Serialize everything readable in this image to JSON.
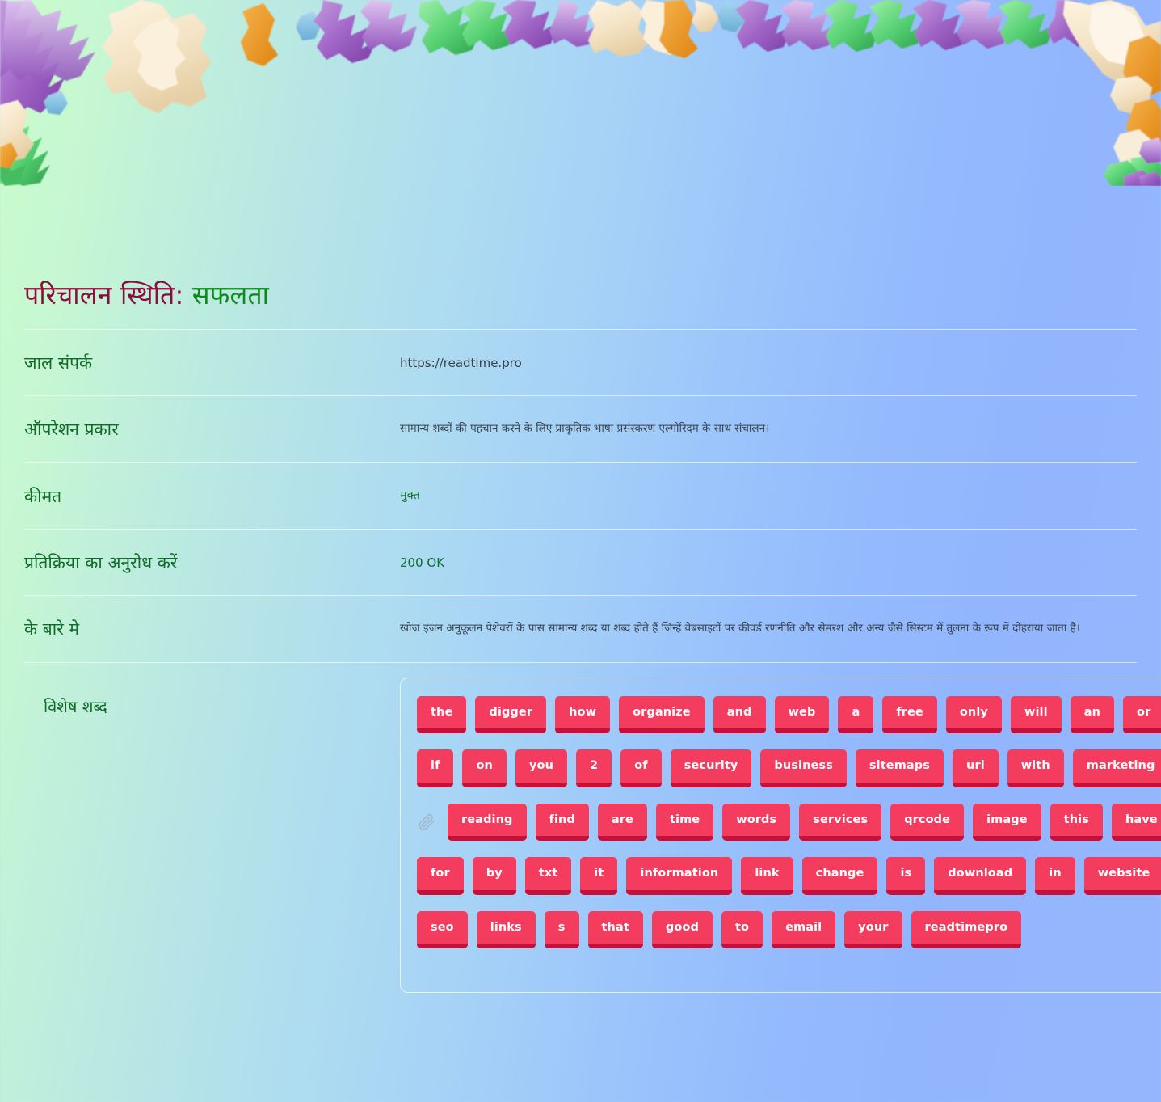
{
  "title": {
    "main": "परिचालन स्थिति:",
    "status": "सफलता",
    "main_color": "#8d0b3f",
    "status_color": "#0c8a17"
  },
  "rows": [
    {
      "label": "जाल संपर्क",
      "value": "https://readtime.pro",
      "value_style": "v-url"
    },
    {
      "label": "ऑपरेशन प्रकार",
      "value": "सामान्य शब्दों की पहचान करने के लिए प्राकृतिक भाषा प्रसंस्करण एल्गोरिदम के साथ संचालन।",
      "value_style": "v-hindi"
    },
    {
      "label": "कीमत",
      "value": "मुक्त",
      "value_style": "v-green"
    },
    {
      "label": "प्रतिक्रिया का अनुरोध करें",
      "value": "200 OK",
      "value_style": "v-code"
    },
    {
      "label": "के बारे मे",
      "value": "खोज इंजन अनुकूलन पेशेवरों के पास सामान्य शब्द या शब्द होते हैं जिन्हें वेबसाइटों पर कीवर्ड रणनीति और सेमरश और अन्य जैसे सिस्टम में तुलना के रूप में दोहराया जाता है।",
      "value_style": "v-hindi"
    }
  ],
  "special_words": {
    "label": "विशेष शब्द",
    "clip_icon": "paperclip-icon",
    "tag_color": "#f43d5e",
    "tag_shadow_color": "#c6103c",
    "rows": [
      [
        "the",
        "digger",
        "how",
        "organize",
        "and",
        "web",
        "a",
        "free",
        "only",
        "will",
        "an",
        "or"
      ],
      [
        "if",
        "on",
        "you",
        "2",
        "of",
        "security",
        "business",
        "sitemaps",
        "url",
        "with",
        "marketing"
      ],
      [
        "reading",
        "find",
        "are",
        "time",
        "words",
        "services",
        "qrcode",
        "image",
        "this",
        "have"
      ],
      [
        "for",
        "by",
        "txt",
        "it",
        "information",
        "link",
        "change",
        "is",
        "download",
        "in",
        "website"
      ],
      [
        "seo",
        "links",
        "s",
        "that",
        "good",
        "to",
        "email",
        "your",
        "readtimepro"
      ]
    ]
  },
  "decoration": {
    "floral_border": "floral-border-decoration",
    "background_gradient_start": "#c9fdcb",
    "background_gradient_end": "#95b6fd"
  }
}
